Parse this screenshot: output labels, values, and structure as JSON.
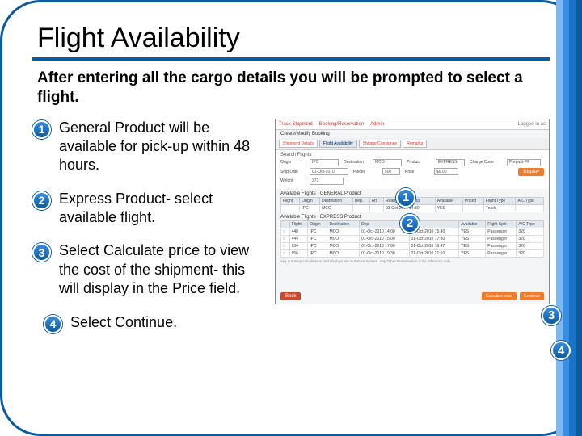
{
  "title": "Flight Availability",
  "intro": "After entering all the cargo details you will be prompted to select a flight.",
  "steps": [
    {
      "num": "1",
      "text": "General Product will be available for pick-up within 48 hours."
    },
    {
      "num": "2",
      "text": "Express Product- select available flight."
    },
    {
      "num": "3",
      "text": "Select  Calculate price to view the cost of the shipment- this will display in the Price field."
    },
    {
      "num": "4",
      "text": "Select Continue."
    }
  ],
  "callouts": {
    "c1": "1",
    "c2": "2",
    "c3": "3",
    "c4": "4"
  },
  "screenshot": {
    "breadcrumb_title": "Create/Modify Booking",
    "topnav": [
      "Track Shipment",
      "Booking/Reservation",
      "Admin"
    ],
    "toplink": "Logged in as",
    "tabs": [
      "Shipment Details",
      "Flight Availability",
      "Shipper/Consignee",
      "Remarks"
    ],
    "search_label": "Search Flights",
    "fields": {
      "origin_lbl": "Origin",
      "origin": "IPC",
      "dest_lbl": "Destination",
      "dest": "MCO",
      "product_lbl": "Product",
      "product": "EXPRESS",
      "charge_lbl": "Charge Code",
      "charge": "Prepaid-PP",
      "date_lbl": "Ship Date",
      "date": "01-Oct-2010",
      "pcs_lbl": "Pieces",
      "pcs": "500",
      "weight_lbl": "Weight",
      "weight": "272",
      "price_lbl": "Price",
      "price": "$0.00"
    },
    "display_btn": "Display",
    "section1_lbl": "Available Flights · GENERAL Product",
    "table1": {
      "headers": [
        "Flight",
        "Origin",
        "Destination",
        "Dep.",
        "Arr.",
        "Ready For Pick-Up",
        "Available",
        "Priced",
        "Flight Type",
        "A/C Type"
      ],
      "row": [
        "",
        "IPC",
        "MCO",
        "",
        "",
        "03-Oct-2010 14:30",
        "YES",
        "",
        "Truck",
        ""
      ]
    },
    "section2_lbl": "Available Flights · EXPRESS Product",
    "table2": {
      "headers": [
        "",
        "Flight",
        "Origin",
        "Destination",
        "Dep.",
        "Arr.",
        "Available",
        "Flight Split",
        "A/C Type"
      ],
      "rows": [
        [
          "",
          "448",
          "IPC",
          "MCO",
          "01-Oct-2010 14:00",
          "01-Oct-2010 15:40",
          "YES",
          "Passenger",
          "320"
        ],
        [
          "",
          "444",
          "IPC",
          "MCO",
          "01-Oct-2010 15:00",
          "01-Oct-2010 17:30",
          "YES",
          "Passenger",
          "320"
        ],
        [
          "",
          "954",
          "IPC",
          "MCO",
          "01-Oct-2010 17:00",
          "01-Oct-2010 18:47",
          "YES",
          "Passenger",
          "320"
        ],
        [
          "",
          "956",
          "IPC",
          "MCO",
          "01-Oct-2010 19:30",
          "01-Oct-2010 21:10",
          "YES",
          "Passenger",
          "320"
        ]
      ]
    },
    "note": "Any currency calculations and displays are in Future System. Any Other Presentation is for reference only.",
    "back_btn": "Back",
    "calc_btn": "Calculate price",
    "continue_btn": "Continue"
  }
}
